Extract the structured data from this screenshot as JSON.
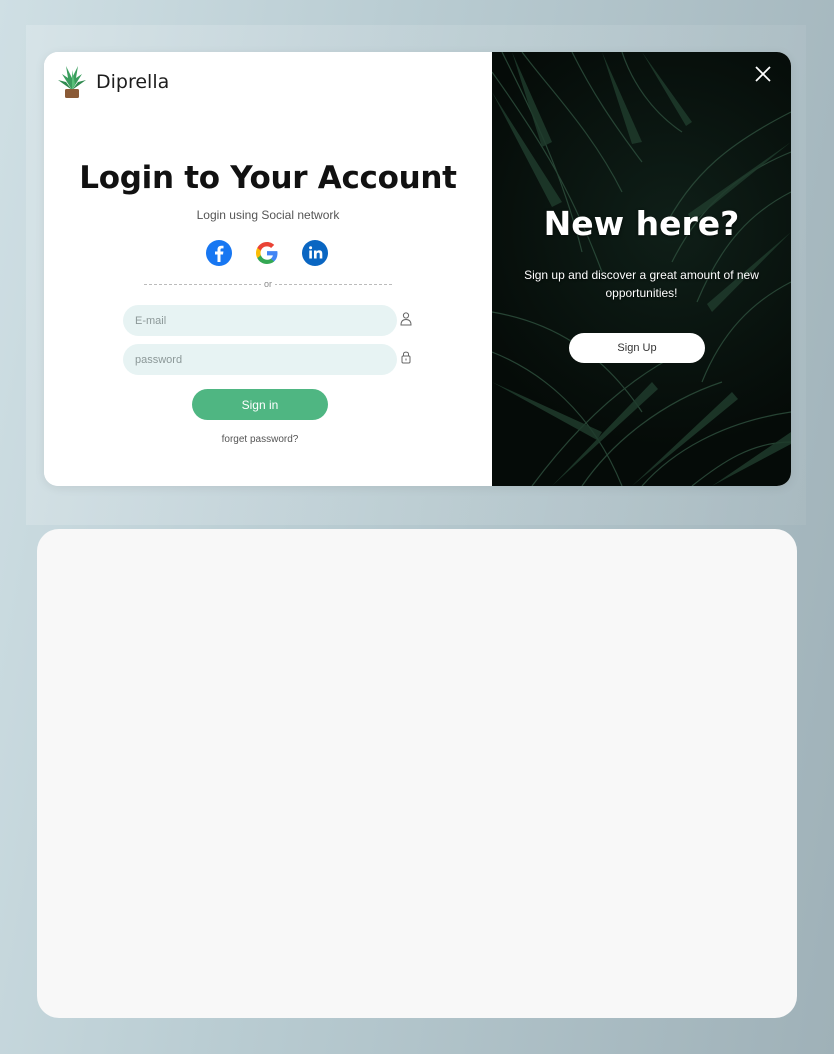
{
  "brand": {
    "name": "Diprella",
    "logo_icon": "plant-icon"
  },
  "login": {
    "title": "Login to Your Account",
    "subtitle": "Login using Social network",
    "socials": [
      {
        "name": "facebook-icon",
        "color": "#1877f2"
      },
      {
        "name": "google-icon",
        "color": "#4285f4"
      },
      {
        "name": "linkedin-icon",
        "color": "#0a66c2"
      }
    ],
    "divider_text": "or",
    "email_placeholder": "E-mail",
    "password_placeholder": "password",
    "signin_label": "Sign in",
    "forget_label": "forget password?"
  },
  "signup": {
    "title": "New here?",
    "description": "Sign up and discover a great amount of new opportunities!",
    "button_label": "Sign Up"
  },
  "colors": {
    "accent": "#4fb682",
    "field_bg": "#e7f3f3",
    "dark_panel": "#07110c"
  }
}
